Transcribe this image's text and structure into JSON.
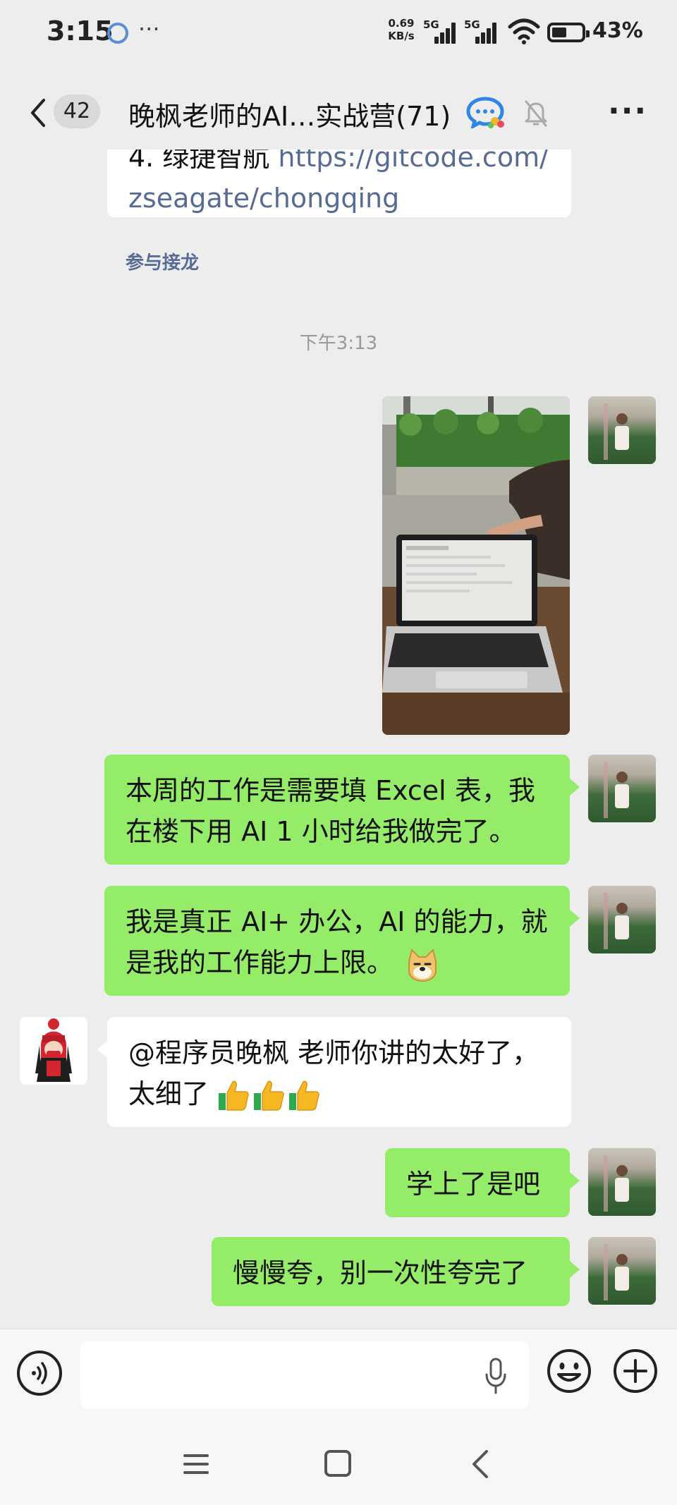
{
  "status_bar": {
    "time": "3:15",
    "overflow": "···",
    "net_speed_value": "0.69",
    "net_speed_unit": "KB/s",
    "sim1_label": "5G",
    "sim2_label": "5G",
    "battery": "43%",
    "battery_level": 0.43
  },
  "header": {
    "unread_count": "42",
    "title": "晚枫老师的AI…实战营(71)",
    "more_label": "···",
    "icons": [
      "back-icon",
      "group-chat-icon",
      "mute-bell-icon",
      "more-icon"
    ]
  },
  "messages": {
    "partial": {
      "line1_prefix": "4. 绿捷智航 ",
      "line1_link": "https://gitcode.com/",
      "line2_link": "zseagate/chongqing"
    },
    "chain_link": "参与接龙",
    "timestamp": "下午3:13",
    "msg1": {
      "line1": "本周的工作是需要填 Excel 表，我",
      "line2": "在楼下用 AI  1 小时给我做完了。"
    },
    "msg2": {
      "line1": "我是真正 AI+ 办公，AI 的能力，就",
      "line2": "是我的工作能力上限。"
    },
    "msg3": {
      "line1": "@程序员晚枫  老师你讲的太好了，",
      "line2": "太细了"
    },
    "msg4": {
      "text": "学上了是吧"
    },
    "msg5": {
      "text": "慢慢夸，别一次性夸完了"
    }
  },
  "input": {
    "value": "",
    "placeholder": ""
  },
  "colors": {
    "background": "#ededed",
    "my_bubble": "#95ec69",
    "other_bubble": "#ffffff",
    "link": "#576b95"
  }
}
